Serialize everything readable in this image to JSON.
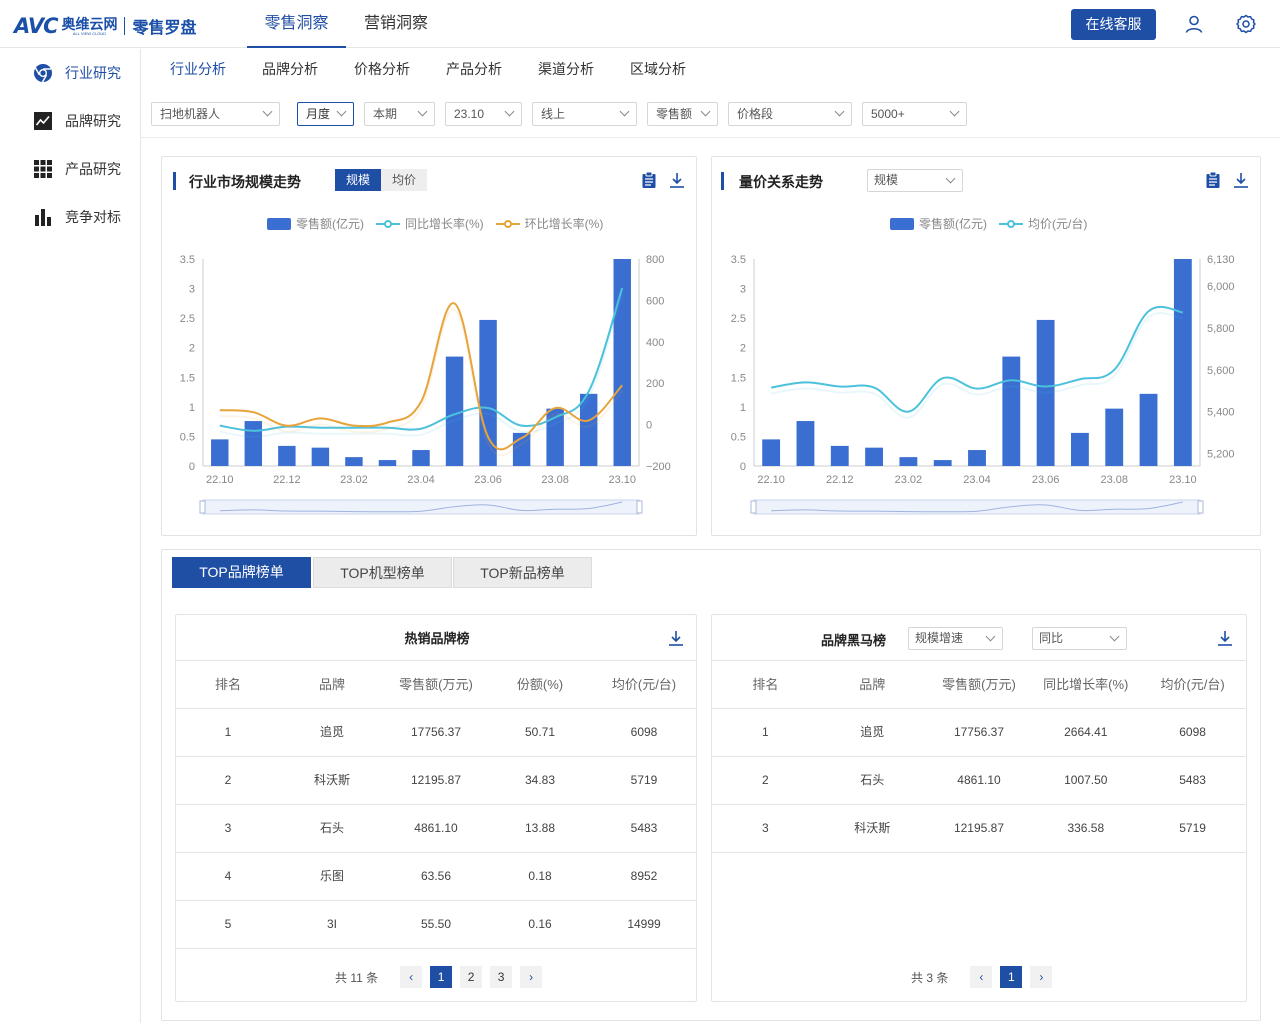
{
  "header": {
    "logo_main": "AVC",
    "logo_cn": "奥维云网",
    "logo_sub": "ALL VIEW CLOUD",
    "logo_product": "零售罗盘",
    "tabs": [
      {
        "label": "零售洞察",
        "active": true
      },
      {
        "label": "营销洞察",
        "active": false
      }
    ],
    "service_label": "在线客服",
    "icons": [
      "user-icon",
      "gear-icon"
    ]
  },
  "sidebar": {
    "items": [
      {
        "label": "行业研究",
        "icon": "chrome-icon",
        "active": true
      },
      {
        "label": "品牌研究",
        "icon": "trend-chart-icon",
        "active": false
      },
      {
        "label": "产品研究",
        "icon": "grid-icon",
        "active": false
      },
      {
        "label": "竞争对标",
        "icon": "bar-chart-icon",
        "active": false
      }
    ]
  },
  "subnav": [
    {
      "label": "行业分析",
      "active": true
    },
    {
      "label": "品牌分析",
      "active": false
    },
    {
      "label": "价格分析",
      "active": false
    },
    {
      "label": "产品分析",
      "active": false
    },
    {
      "label": "渠道分析",
      "active": false
    },
    {
      "label": "区域分析",
      "active": false
    }
  ],
  "filters": [
    {
      "value": "扫地机器人",
      "active": false
    },
    {
      "value": "月度",
      "active": true
    },
    {
      "value": "本期",
      "active": false
    },
    {
      "value": "23.10",
      "active": false
    },
    {
      "value": "线上",
      "active": false
    },
    {
      "value": "零售额",
      "active": false
    },
    {
      "value": "价格段",
      "active": false
    },
    {
      "value": "5000+",
      "active": false
    }
  ],
  "panel_left": {
    "title": "行业市场规模走势",
    "toggle": [
      "规模",
      "均价"
    ],
    "legend": [
      "零售额(亿元)",
      "同比增长率(%)",
      "环比增长率(%)"
    ]
  },
  "panel_right": {
    "title": "量价关系走势",
    "select": "规模",
    "legend": [
      "零售额(亿元)",
      "均价(元/台)"
    ]
  },
  "colors": {
    "accent": "#1f4ea5",
    "bar": "#3a6fd1",
    "line_teal": "#4bc1dc",
    "line_orange": "#e8a33a"
  },
  "chart_data": [
    {
      "type": "bar",
      "categories": [
        "22.10",
        "22.11",
        "22.12",
        "23.01",
        "23.02",
        "23.03",
        "23.04",
        "23.05",
        "23.06",
        "23.07",
        "23.08",
        "23.09",
        "23.10"
      ],
      "x_tick_labels": [
        "22.10",
        "22.12",
        "23.02",
        "23.04",
        "23.06",
        "23.08",
        "23.10"
      ],
      "ylim": [
        0,
        3.5
      ],
      "y_ticks": [
        "0",
        "0.5",
        "1",
        "1.5",
        "2",
        "2.5",
        "3",
        "3.5"
      ],
      "y2lim": [
        -200,
        800
      ],
      "y2_ticks": [
        "−200",
        "0",
        "200",
        "400",
        "600",
        "800"
      ],
      "series": [
        {
          "name": "零售额(亿元)",
          "type": "bar",
          "axis": "left",
          "values": [
            0.45,
            0.76,
            0.34,
            0.31,
            0.15,
            0.1,
            0.27,
            1.85,
            2.47,
            0.56,
            0.97,
            1.22,
            3.5
          ]
        },
        {
          "name": "同比增长率(%)",
          "type": "line",
          "axis": "right",
          "values": [
            -5,
            -30,
            -10,
            -15,
            -15,
            -15,
            -20,
            50,
            80,
            -5,
            35,
            160,
            660
          ]
        },
        {
          "name": "环比增长率(%)",
          "type": "line",
          "axis": "right",
          "values": [
            70,
            60,
            -5,
            30,
            -5,
            10,
            110,
            585,
            -60,
            -65,
            80,
            20,
            190
          ]
        }
      ]
    },
    {
      "type": "bar",
      "categories": [
        "22.10",
        "22.11",
        "22.12",
        "23.01",
        "23.02",
        "23.03",
        "23.04",
        "23.05",
        "23.06",
        "23.07",
        "23.08",
        "23.09",
        "23.10"
      ],
      "x_tick_labels": [
        "22.10",
        "22.12",
        "23.02",
        "23.04",
        "23.06",
        "23.08",
        "23.10"
      ],
      "ylim": [
        0,
        3.5
      ],
      "y_ticks": [
        "0",
        "0.5",
        "1",
        "1.5",
        "2",
        "2.5",
        "3",
        "3.5"
      ],
      "y2lim": [
        5140,
        6130
      ],
      "y2_ticks": [
        "5,200",
        "5,400",
        "5,600",
        "5,800",
        "6,000",
        "6,130"
      ],
      "series": [
        {
          "name": "零售额(亿元)",
          "type": "bar",
          "axis": "left",
          "values": [
            0.45,
            0.76,
            0.34,
            0.31,
            0.15,
            0.1,
            0.27,
            1.85,
            2.47,
            0.56,
            0.97,
            1.22,
            3.5
          ]
        },
        {
          "name": "均价(元/台)",
          "type": "line",
          "axis": "right",
          "values": [
            5515,
            5540,
            5520,
            5515,
            5400,
            5560,
            5510,
            5550,
            5520,
            5555,
            5600,
            5880,
            5875
          ]
        }
      ]
    }
  ],
  "bottom_tabs": [
    {
      "label": "TOP品牌榜单",
      "active": true
    },
    {
      "label": "TOP机型榜单",
      "active": false
    },
    {
      "label": "TOP新品榜单",
      "active": false
    }
  ],
  "hot_brands": {
    "title": "热销品牌榜",
    "columns": [
      "排名",
      "品牌",
      "零售额(万元)",
      "份额(%)",
      "均价(元/台)"
    ],
    "rows": [
      [
        "1",
        "追觅",
        "17756.37",
        "50.71",
        "6098"
      ],
      [
        "2",
        "科沃斯",
        "12195.87",
        "34.83",
        "5719"
      ],
      [
        "3",
        "石头",
        "4861.10",
        "13.88",
        "5483"
      ],
      [
        "4",
        "乐图",
        "63.56",
        "0.18",
        "8952"
      ],
      [
        "5",
        "3I",
        "55.50",
        "0.16",
        "14999"
      ]
    ],
    "total": "共 11 条",
    "pages": [
      "1",
      "2",
      "3"
    ],
    "current_page": "1"
  },
  "dark_horse": {
    "title": "品牌黑马榜",
    "select1": "规模增速",
    "select2": "同比",
    "columns": [
      "排名",
      "品牌",
      "零售额(万元)",
      "同比增长率(%)",
      "均价(元/台)"
    ],
    "rows": [
      [
        "1",
        "追觅",
        "17756.37",
        "2664.41",
        "6098"
      ],
      [
        "2",
        "石头",
        "4861.10",
        "1007.50",
        "5483"
      ],
      [
        "3",
        "科沃斯",
        "12195.87",
        "336.58",
        "5719"
      ]
    ],
    "total": "共 3 条",
    "pages": [
      "1"
    ],
    "current_page": "1"
  }
}
